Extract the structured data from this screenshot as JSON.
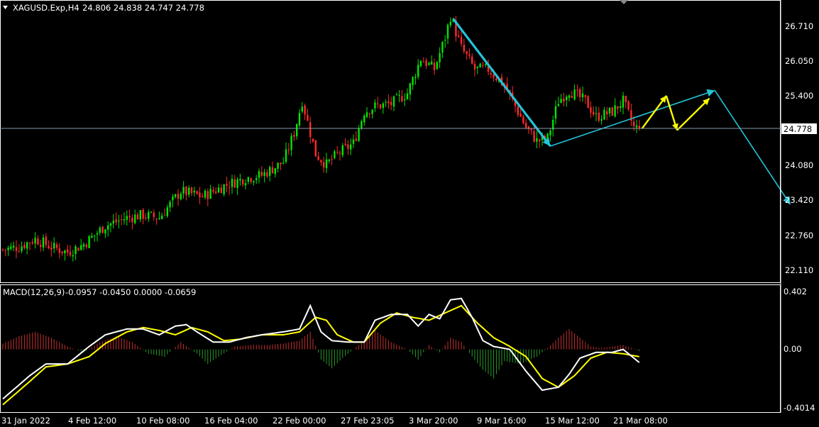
{
  "header": {
    "symbol": "XAGUSD.Exp,H4",
    "ohlc": "24.806 24.838 24.747 24.778"
  },
  "macd_header": {
    "label": "MACD(12,26,9)",
    "values": "-0.0957 -0.0450 0.0000 -0.0659"
  },
  "colors": {
    "background": "#000000",
    "bull_candle": "#00e600",
    "bear_candle": "#ff2a2a",
    "frame": "#ffffff",
    "trend_arrow": "#22c4d8",
    "projection_arrow": "#ffff00",
    "macd_line": "#ffffff",
    "signal_line": "#ffff00",
    "hist_positive": "#c83030",
    "hist_negative": "#2a9a2a",
    "price_marker_bg": "#ffffff"
  },
  "chart_data": [
    {
      "type": "candlestick",
      "title": "XAGUSD.Exp,H4",
      "y_ticks": [
        "26.710",
        "26.050",
        "25.400",
        "24.080",
        "23.420",
        "22.760",
        "22.110"
      ],
      "ylim": [
        22.0,
        27.0
      ],
      "current_price": "24.778",
      "x_tick_labels": [
        "31 Jan 2022",
        "4 Feb 12:00",
        "10 Feb 08:00",
        "16 Feb 04:00",
        "22 Feb 00:00",
        "27 Feb 23:05",
        "3 Mar 20:00",
        "9 Mar 16:00",
        "15 Mar 12:00",
        "21 Mar 08:00"
      ],
      "price_path": [
        [
          0,
          22.5
        ],
        [
          6,
          22.55
        ],
        [
          12,
          22.7
        ],
        [
          18,
          22.55
        ],
        [
          24,
          22.45
        ],
        [
          30,
          22.6
        ],
        [
          38,
          22.95
        ],
        [
          46,
          23.1
        ],
        [
          52,
          23.15
        ],
        [
          58,
          23.1
        ],
        [
          66,
          23.6
        ],
        [
          74,
          23.5
        ],
        [
          82,
          23.7
        ],
        [
          90,
          23.85
        ],
        [
          96,
          23.9
        ],
        [
          104,
          24.15
        ],
        [
          108,
          24.7
        ],
        [
          111,
          25.3
        ],
        [
          113,
          24.9
        ],
        [
          116,
          24.3
        ],
        [
          120,
          24.1
        ],
        [
          124,
          24.3
        ],
        [
          130,
          24.5
        ],
        [
          134,
          25.1
        ],
        [
          138,
          25.2
        ],
        [
          144,
          25.25
        ],
        [
          150,
          25.45
        ],
        [
          155,
          26.1
        ],
        [
          160,
          25.9
        ],
        [
          164,
          26.5
        ],
        [
          166,
          26.9
        ],
        [
          170,
          26.3
        ],
        [
          175,
          25.9
        ],
        [
          180,
          25.9
        ],
        [
          186,
          25.6
        ],
        [
          194,
          24.8
        ],
        [
          198,
          24.55
        ],
        [
          202,
          24.6
        ],
        [
          206,
          25.3
        ],
        [
          210,
          25.5
        ],
        [
          216,
          25.3
        ],
        [
          220,
          25.0
        ],
        [
          226,
          25.1
        ],
        [
          230,
          25.3
        ],
        [
          234,
          24.8
        ],
        [
          236,
          24.78
        ]
      ],
      "annotations": [
        {
          "kind": "trend_arrow",
          "color": "cyan",
          "from": [
            167,
            26.85
          ],
          "to": [
            203,
            24.45
          ]
        },
        {
          "kind": "trend_line",
          "color": "cyan",
          "from": [
            203,
            24.45
          ],
          "to": [
            264,
            25.5
          ]
        },
        {
          "kind": "trend_line",
          "color": "cyan",
          "from": [
            264,
            25.5
          ],
          "to": [
            292,
            23.35
          ]
        },
        {
          "kind": "projection",
          "color": "yellow",
          "points": [
            [
              237,
              24.78
            ],
            [
              246,
              25.4
            ],
            [
              250,
              24.75
            ],
            [
              262,
              25.35
            ]
          ]
        }
      ]
    },
    {
      "type": "macd",
      "title": "MACD(12,26,9)",
      "y_ticks": [
        "0.402",
        "0.00",
        "-0.4014"
      ],
      "ylim": [
        -0.4014,
        0.402
      ],
      "macd_path": [
        [
          0,
          -0.34
        ],
        [
          10,
          -0.18
        ],
        [
          16,
          -0.1
        ],
        [
          24,
          -0.1
        ],
        [
          32,
          0.02
        ],
        [
          38,
          0.1
        ],
        [
          46,
          0.14
        ],
        [
          52,
          0.14
        ],
        [
          58,
          0.1
        ],
        [
          64,
          0.16
        ],
        [
          68,
          0.17
        ],
        [
          72,
          0.12
        ],
        [
          78,
          0.05
        ],
        [
          84,
          0.05
        ],
        [
          90,
          0.08
        ],
        [
          96,
          0.1
        ],
        [
          104,
          0.12
        ],
        [
          110,
          0.14
        ],
        [
          114,
          0.3
        ],
        [
          118,
          0.12
        ],
        [
          122,
          0.06
        ],
        [
          128,
          0.05
        ],
        [
          134,
          0.05
        ],
        [
          138,
          0.2
        ],
        [
          144,
          0.24
        ],
        [
          150,
          0.24
        ],
        [
          154,
          0.16
        ],
        [
          158,
          0.24
        ],
        [
          162,
          0.21
        ],
        [
          166,
          0.34
        ],
        [
          170,
          0.35
        ],
        [
          174,
          0.22
        ],
        [
          178,
          0.06
        ],
        [
          182,
          0.02
        ],
        [
          188,
          0.0
        ],
        [
          194,
          -0.15
        ],
        [
          200,
          -0.28
        ],
        [
          206,
          -0.26
        ],
        [
          210,
          -0.17
        ],
        [
          214,
          -0.06
        ],
        [
          220,
          -0.02
        ],
        [
          226,
          -0.02
        ],
        [
          230,
          0.0
        ],
        [
          236,
          -0.09
        ]
      ],
      "signal_path": [
        [
          0,
          -0.38
        ],
        [
          10,
          -0.22
        ],
        [
          16,
          -0.12
        ],
        [
          24,
          -0.1
        ],
        [
          32,
          -0.05
        ],
        [
          38,
          0.04
        ],
        [
          46,
          0.12
        ],
        [
          52,
          0.15
        ],
        [
          58,
          0.13
        ],
        [
          64,
          0.1
        ],
        [
          70,
          0.15
        ],
        [
          76,
          0.12
        ],
        [
          82,
          0.06
        ],
        [
          88,
          0.07
        ],
        [
          96,
          0.1
        ],
        [
          104,
          0.1
        ],
        [
          110,
          0.12
        ],
        [
          116,
          0.22
        ],
        [
          120,
          0.2
        ],
        [
          124,
          0.1
        ],
        [
          130,
          0.05
        ],
        [
          134,
          0.05
        ],
        [
          140,
          0.18
        ],
        [
          146,
          0.25
        ],
        [
          152,
          0.22
        ],
        [
          158,
          0.2
        ],
        [
          164,
          0.25
        ],
        [
          170,
          0.3
        ],
        [
          176,
          0.18
        ],
        [
          182,
          0.08
        ],
        [
          188,
          0.02
        ],
        [
          194,
          -0.05
        ],
        [
          200,
          -0.2
        ],
        [
          206,
          -0.26
        ],
        [
          212,
          -0.18
        ],
        [
          218,
          -0.06
        ],
        [
          224,
          -0.02
        ],
        [
          230,
          -0.03
        ],
        [
          236,
          -0.05
        ]
      ],
      "histogram_path": [
        [
          0,
          0.04
        ],
        [
          6,
          0.09
        ],
        [
          12,
          0.12
        ],
        [
          18,
          0.08
        ],
        [
          24,
          0.02
        ],
        [
          30,
          -0.02
        ],
        [
          36,
          0.05
        ],
        [
          42,
          0.09
        ],
        [
          48,
          0.05
        ],
        [
          54,
          -0.03
        ],
        [
          60,
          -0.05
        ],
        [
          66,
          0.05
        ],
        [
          72,
          -0.03
        ],
        [
          76,
          -0.1
        ],
        [
          80,
          -0.05
        ],
        [
          86,
          0.02
        ],
        [
          92,
          0.03
        ],
        [
          98,
          0.03
        ],
        [
          104,
          0.04
        ],
        [
          110,
          0.06
        ],
        [
          114,
          0.12
        ],
        [
          118,
          -0.07
        ],
        [
          122,
          -0.13
        ],
        [
          126,
          -0.06
        ],
        [
          130,
          0.0
        ],
        [
          134,
          0.06
        ],
        [
          138,
          0.13
        ],
        [
          144,
          0.05
        ],
        [
          150,
          0.0
        ],
        [
          154,
          -0.07
        ],
        [
          158,
          0.03
        ],
        [
          162,
          -0.02
        ],
        [
          166,
          0.08
        ],
        [
          170,
          0.05
        ],
        [
          174,
          -0.05
        ],
        [
          178,
          -0.14
        ],
        [
          182,
          -0.2
        ],
        [
          186,
          -0.08
        ],
        [
          192,
          -0.1
        ],
        [
          198,
          -0.05
        ],
        [
          202,
          0.01
        ],
        [
          206,
          0.08
        ],
        [
          210,
          0.14
        ],
        [
          214,
          0.08
        ],
        [
          218,
          0.02
        ],
        [
          222,
          0.01
        ],
        [
          226,
          0.02
        ],
        [
          230,
          0.03
        ],
        [
          236,
          -0.01
        ]
      ]
    }
  ]
}
